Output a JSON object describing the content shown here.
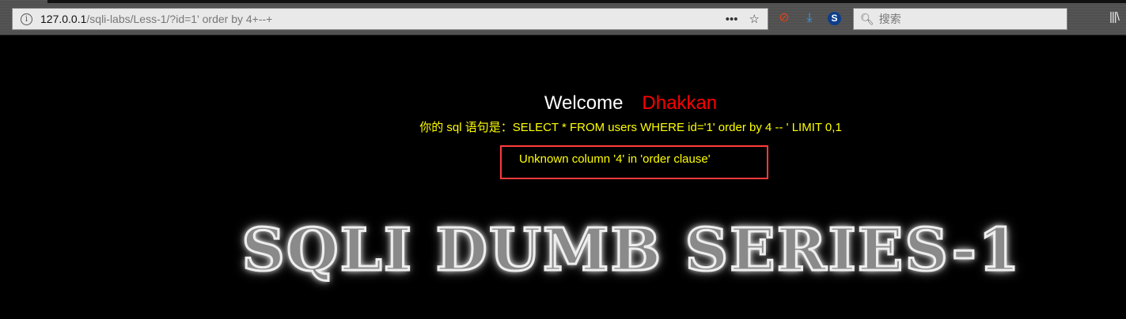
{
  "browser": {
    "url_host": "127.0.0.1",
    "url_path": "/sqli-labs/Less-1/?id=1' order by 4+--+",
    "more_icon": "ellipsis-icon",
    "bookmark_icon": "star-icon",
    "search_placeholder": "搜索",
    "extensions": [
      "blocked-extension-icon",
      "download-icon",
      "s-extension-icon"
    ],
    "library_icon": "library-icon"
  },
  "page": {
    "welcome": "Welcome",
    "name": "Dhakkan",
    "sql_line": "你的 sql 语句是：SELECT * FROM users WHERE id='1' order by 4 -- ' LIMIT 0,1",
    "error": "Unknown column '4' in 'order clause'",
    "logo_text": "SQLI DUMB SERIES-1"
  },
  "colors": {
    "name": "#ff0000",
    "sql": "#ffff00",
    "highlight_box": "#ff3b3b"
  }
}
